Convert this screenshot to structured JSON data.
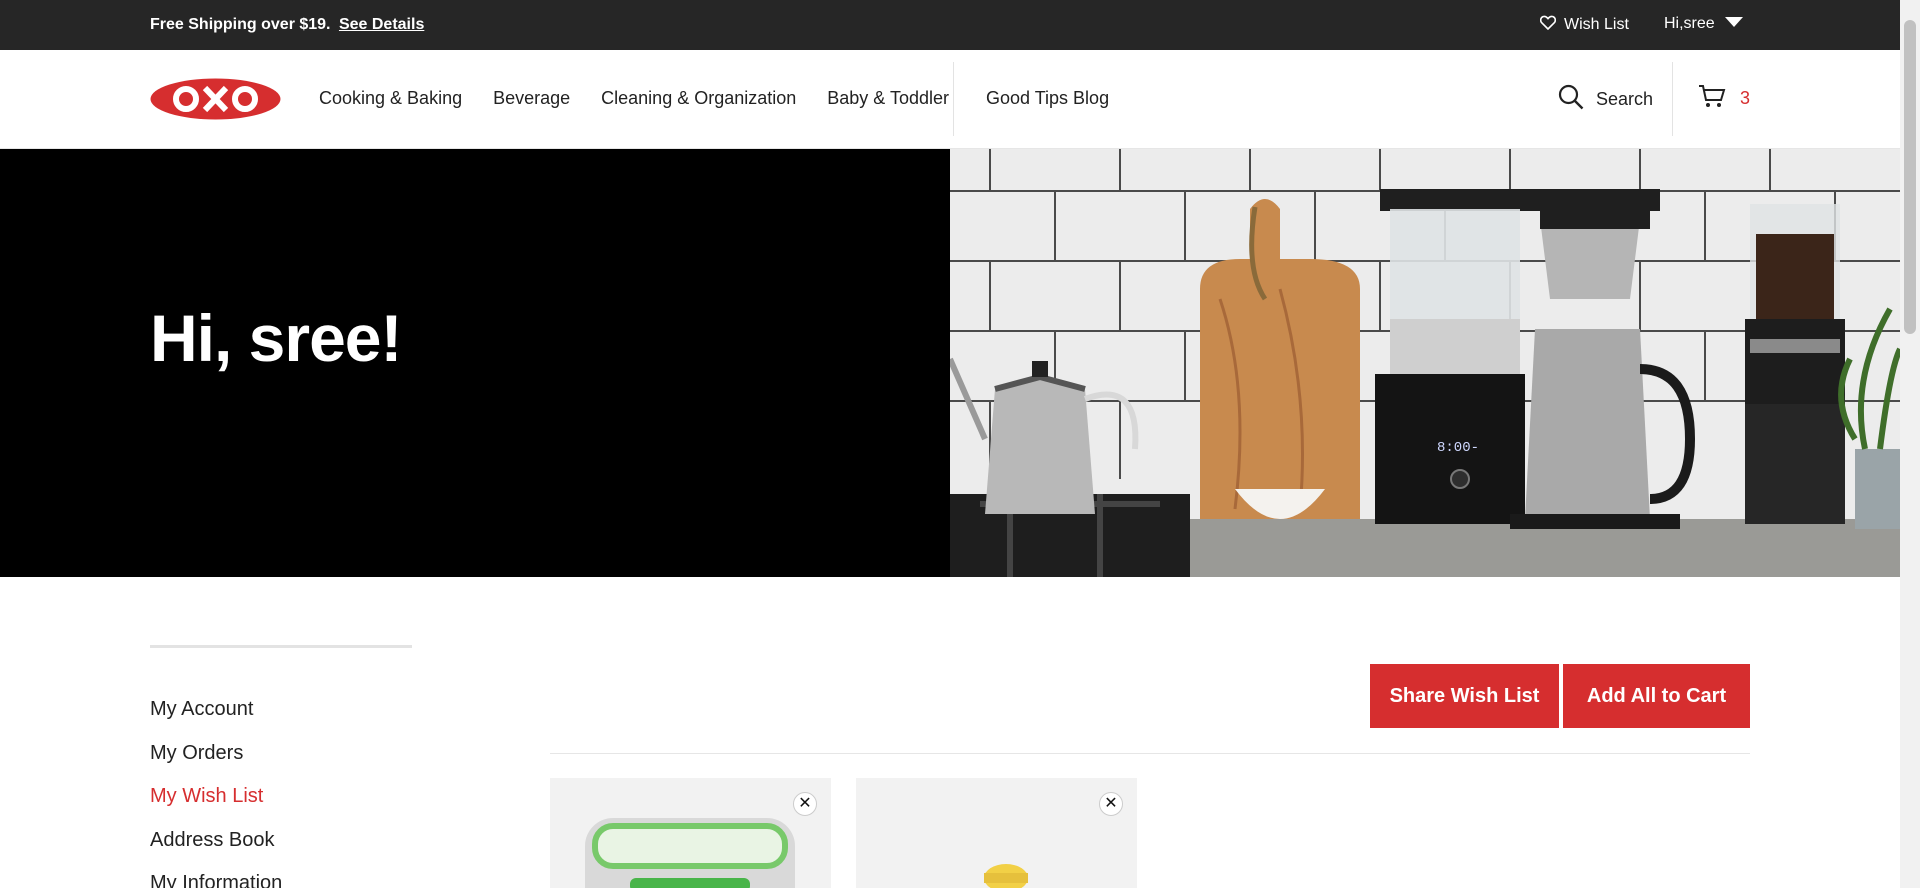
{
  "topbar": {
    "promo_text": "Free Shipping over $19.",
    "promo_link": "See Details",
    "wish_list_label": "Wish List",
    "user_greeting": "Hi,sree"
  },
  "header": {
    "logo_text": "OXO",
    "nav": [
      "Cooking & Baking",
      "Beverage",
      "Cleaning & Organization",
      "Baby & Toddler"
    ],
    "blog": "Good Tips Blog",
    "search_label": "Search",
    "cart_count": "3"
  },
  "hero": {
    "title": "Hi, sree!"
  },
  "sidebar": {
    "items": [
      {
        "label": "My Account",
        "active": false
      },
      {
        "label": "My Orders",
        "active": false
      },
      {
        "label": "My Wish List",
        "active": true
      },
      {
        "label": "Address Book",
        "active": false
      },
      {
        "label": "My Information",
        "active": false
      }
    ]
  },
  "wishlist": {
    "share_label": "Share Wish List",
    "add_all_label": "Add All to Cart",
    "remove_glyph": "✕"
  },
  "colors": {
    "brand_red": "#d62e2f",
    "topbar_bg": "#262626"
  }
}
